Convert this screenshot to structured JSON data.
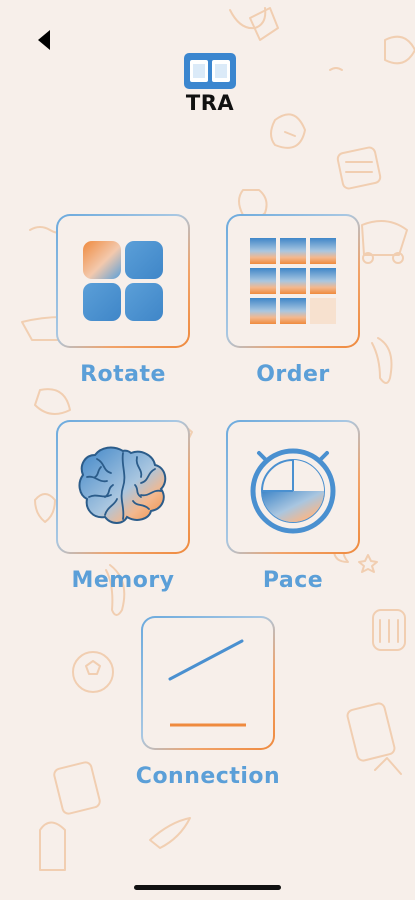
{
  "logo": {
    "text": "TRA"
  },
  "games": [
    {
      "label": "Rotate",
      "icon": "rotate-squares-icon"
    },
    {
      "label": "Order",
      "icon": "order-grid-icon"
    },
    {
      "label": "Memory",
      "icon": "brain-icon"
    },
    {
      "label": "Pace",
      "icon": "stopwatch-icon"
    },
    {
      "label": "Connection",
      "icon": "connection-lines-icon"
    }
  ],
  "colors": {
    "background": "#f7efea",
    "accent_blue": "#5b9fd8",
    "accent_orange": "#ef8a3e"
  }
}
